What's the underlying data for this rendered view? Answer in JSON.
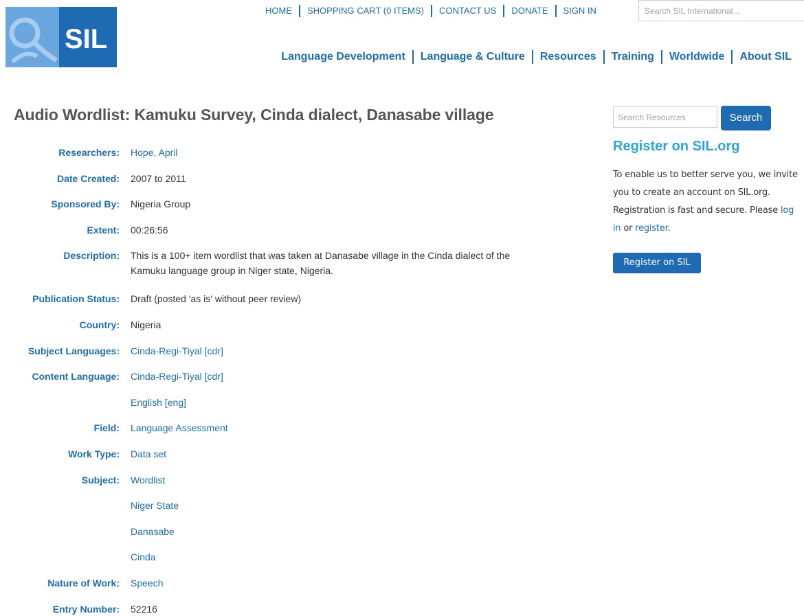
{
  "brand": {
    "logo_text": "SIL"
  },
  "util_nav": {
    "items": [
      "HOME",
      "SHOPPING CART (0 ITEMS)",
      "CONTACT US",
      "DONATE",
      "SIGN IN"
    ],
    "search_placeholder": "Search SIL International..."
  },
  "main_nav": {
    "items": [
      "Language Development",
      "Language & Culture",
      "Resources",
      "Training",
      "Worldwide",
      "About SIL"
    ]
  },
  "page": {
    "title": "Audio Wordlist: Kamuku Survey, Cinda dialect, Danasabe village"
  },
  "details": {
    "researchers_label": "Researchers:",
    "researchers": "Hope, April",
    "date_label": "Date Created:",
    "date": "2007 to 2011",
    "sponsored_label": "Sponsored By:",
    "sponsored": "Nigeria Group",
    "extent_label": "Extent:",
    "extent": "00:26:56",
    "description_label": "Description:",
    "description": "This is a 100+ item wordlist that was taken at Danasabe village in the Cinda dialect of the Kamuku language group in Niger state, Nigeria.",
    "status_label": "Publication Status:",
    "status": "Draft (posted 'as is' without peer review)",
    "country_label": "Country:",
    "country": "Nigeria",
    "subject_lang_label": "Subject Languages:",
    "subject_lang": "Cinda-Regi-Tiyal [cdr]",
    "content_lang_label": "Content Language:",
    "content_lang": [
      "Cinda-Regi-Tiyal [cdr]",
      "English [eng]"
    ],
    "field_label": "Field:",
    "field": "Language Assessment",
    "work_type_label": "Work Type:",
    "work_type": "Data set",
    "subject_label": "Subject:",
    "subject": [
      "Wordlist",
      "Niger State",
      "Danasabe",
      "Cinda"
    ],
    "nature_label": "Nature of Work:",
    "nature": "Speech",
    "entry_label": "Entry Number:",
    "entry": "52216"
  },
  "sidebar": {
    "search_placeholder": "Search Resources",
    "search_button": "Search",
    "register_title": "Register on SIL.org",
    "register_text_1": "To enable us to better serve you, we invite you to create an account on SIL.org. Registration is fast and secure. Please ",
    "login_link": "log in",
    "register_text_2": " or ",
    "register_link": "register",
    "register_text_3": ".",
    "register_button": "Register on SIL"
  },
  "colors": {
    "link": "#1a6fb4",
    "brand_dark": "#1e6bb3",
    "brand_light": "#6aa7df",
    "accent_title": "#2aa6de"
  }
}
